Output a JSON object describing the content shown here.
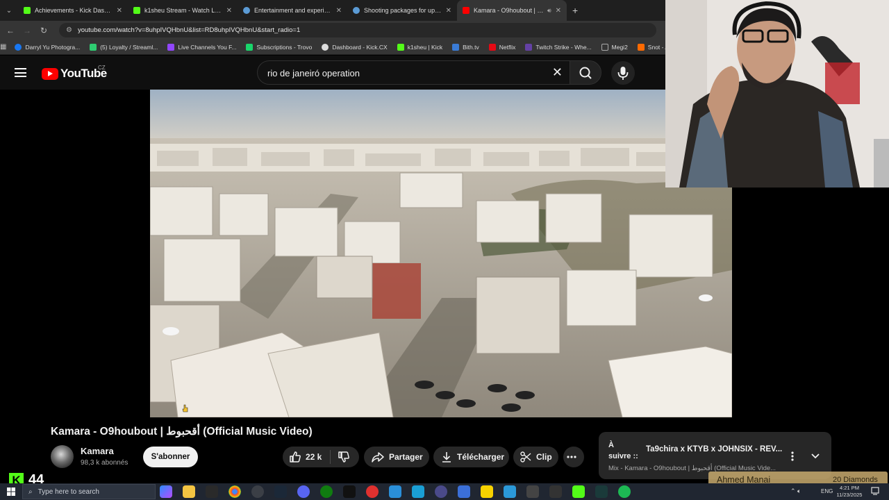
{
  "browser": {
    "tabs": [
      {
        "title": "Achievements - Kick Dashboard",
        "favicon_color": "#53fc18",
        "active": false
      },
      {
        "title": "k1sheu Stream - Watch Live on Kick",
        "favicon_color": "#53fc18",
        "active": false
      },
      {
        "title": "Entertainment and experiences",
        "favicon_color": "#5b9bd5",
        "active": false
      },
      {
        "title": "Shooting packages for up to 4",
        "favicon_color": "#5b9bd5",
        "active": false
      },
      {
        "title": "Kamara - O9houbout | أقحبوط",
        "favicon_color": "#ff0000",
        "active": true
      }
    ],
    "url": "youtube.com/watch?v=8uhpIVQHbnU&list=RD8uhpIVQHbnU&start_radio=1",
    "bookmarks": [
      {
        "label": "Darryl Yu Photogra...",
        "color": "#1877f2"
      },
      {
        "label": "(5) Loyalty / Streaml...",
        "color": "#2ecc71"
      },
      {
        "label": "Live Channels You F...",
        "color": "#9146ff"
      },
      {
        "label": "Subscriptions - Trovo",
        "color": "#19d66b"
      },
      {
        "label": "Dashboard - Kick.CX",
        "color": "#dddddd"
      },
      {
        "label": "k1sheu | Kick",
        "color": "#53fc18"
      },
      {
        "label": "Bith.tv",
        "color": "#3a7bd5"
      },
      {
        "label": "Netflix",
        "color": "#e50914"
      },
      {
        "label": "Twitch Strike - Whe...",
        "color": "#6441a5"
      },
      {
        "label": "Megi2",
        "color": "#aaaaaa"
      },
      {
        "label": "Snot - AI Angour...",
        "color": "#ff6a00"
      }
    ]
  },
  "youtube": {
    "logo_text": "YouTube",
    "region": "CZ",
    "search_query": "rio de janeiró operation"
  },
  "video": {
    "title": "Kamara - O9houbout | أقحبوط (Official Music Video)",
    "channel": "Kamara",
    "subscribers": "98,3 k abonnés",
    "subscribe_label": "S'abonner",
    "likes": "22 k",
    "share_label": "Partager",
    "download_label": "Télécharger",
    "clip_label": "Clip"
  },
  "up_next": {
    "label_a": "À",
    "label_b": "suivre ::",
    "title": "Ta9chira x KTYB x JOHNSIX - REV...",
    "mix": "Mix - Kamara - O9houbout | أقحبوط (Official Music Vide..."
  },
  "overlay": {
    "kick_count": "44",
    "donor": "Ahmed Manai",
    "donation": "20 Diamonds"
  },
  "taskbar": {
    "search_placeholder": "Type here to search",
    "lang": "ENG",
    "time": "4:21 PM",
    "date": "11/23/2025"
  }
}
